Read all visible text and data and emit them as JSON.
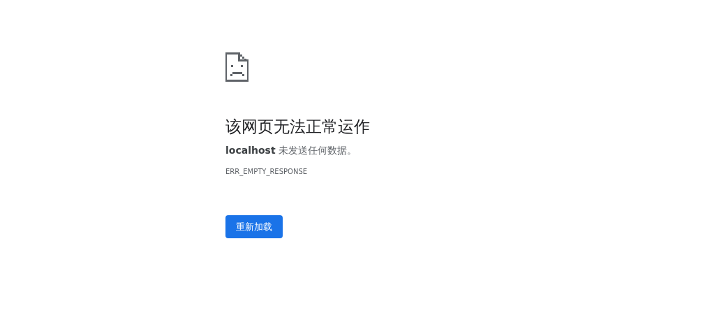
{
  "error_page": {
    "title": "该网页无法正常运作",
    "message": "**localhost** 未发送任何数据。",
    "error_code": "ERR_EMPTY_RESPONSE",
    "reload_button": "重新加载"
  }
}
